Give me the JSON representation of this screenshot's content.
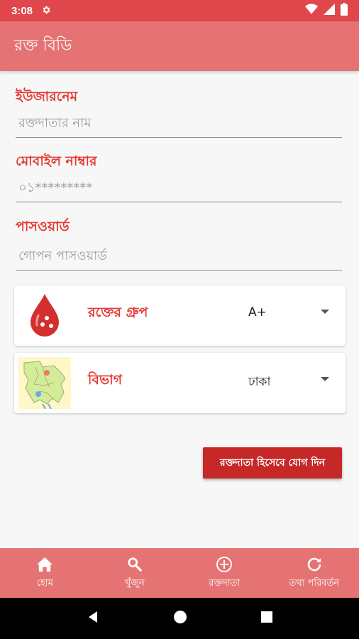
{
  "status_bar": {
    "time": "3:08"
  },
  "app_bar": {
    "title": "রক্ত বিডি"
  },
  "form": {
    "username": {
      "label": "ইউজারনেম",
      "placeholder": "রক্তদাতার নাম"
    },
    "mobile": {
      "label": "মোবাইল নাম্বার",
      "placeholder": "০১*********"
    },
    "password": {
      "label": "পাসওয়ার্ড",
      "placeholder": "গোপন পাসওয়ার্ড"
    }
  },
  "blood_group": {
    "label": "রক্তের গ্রুপ",
    "value": "A+"
  },
  "division": {
    "label": "বিভাগ",
    "value": "ঢাকা"
  },
  "join_button": {
    "label": "রক্তদাতা হিসেবে যোগ দিন"
  },
  "bottom_nav": {
    "items": [
      {
        "label": "হোম",
        "icon": "home-icon"
      },
      {
        "label": "খুঁজুন",
        "icon": "search-icon"
      },
      {
        "label": "রক্তদাতা",
        "icon": "add-circle-icon"
      },
      {
        "label": "তথ্য পরিবর্তন",
        "icon": "refresh-icon"
      }
    ]
  },
  "colors": {
    "status_bar": "#e0474c",
    "app_bar": "#e57373",
    "accent": "#e53935",
    "button": "#c62828"
  }
}
